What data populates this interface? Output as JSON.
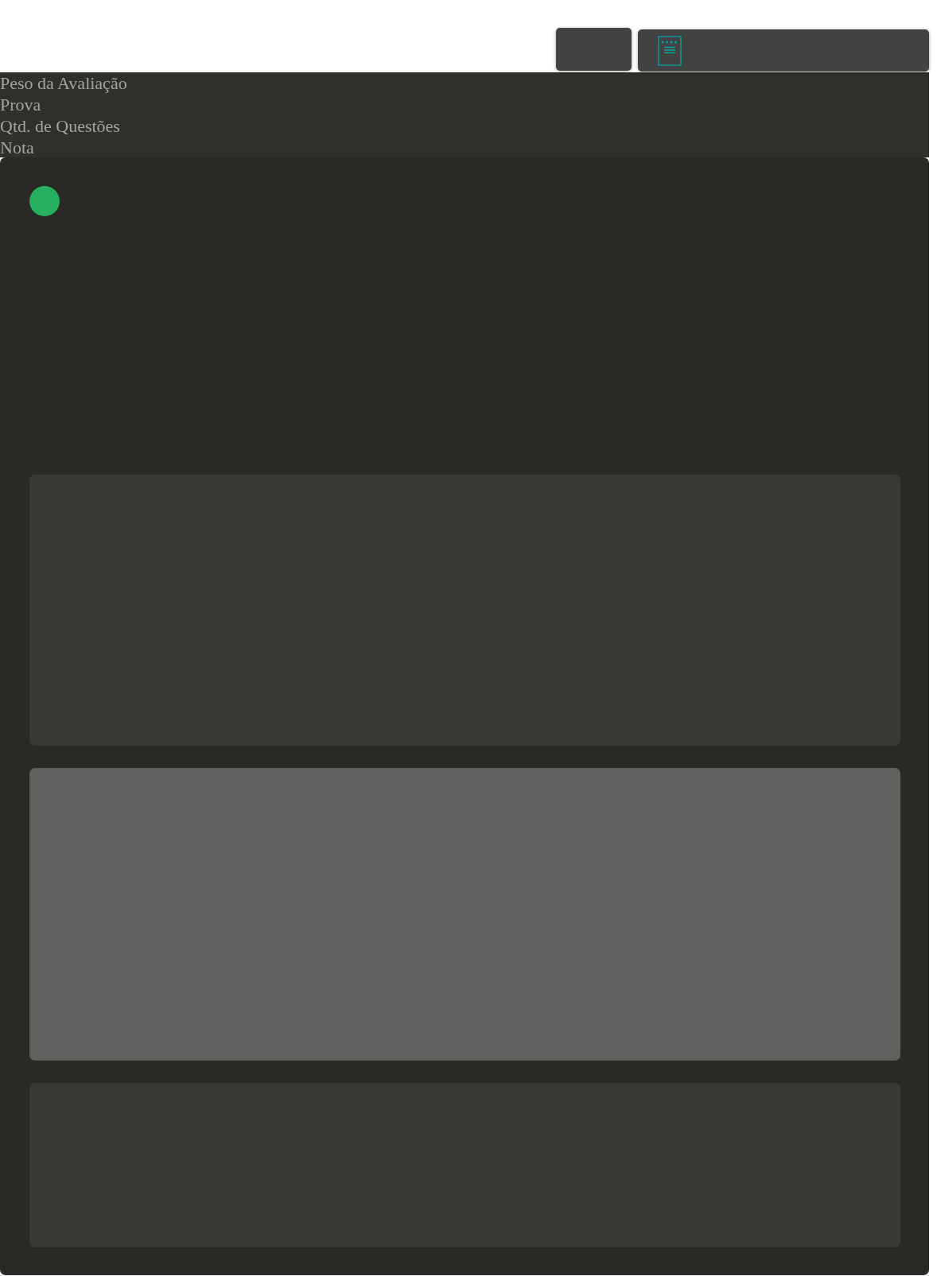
{
  "header_labels": [
    "Peso da Avaliação",
    "Prova",
    "Qtd. de Questões",
    "Nota"
  ]
}
